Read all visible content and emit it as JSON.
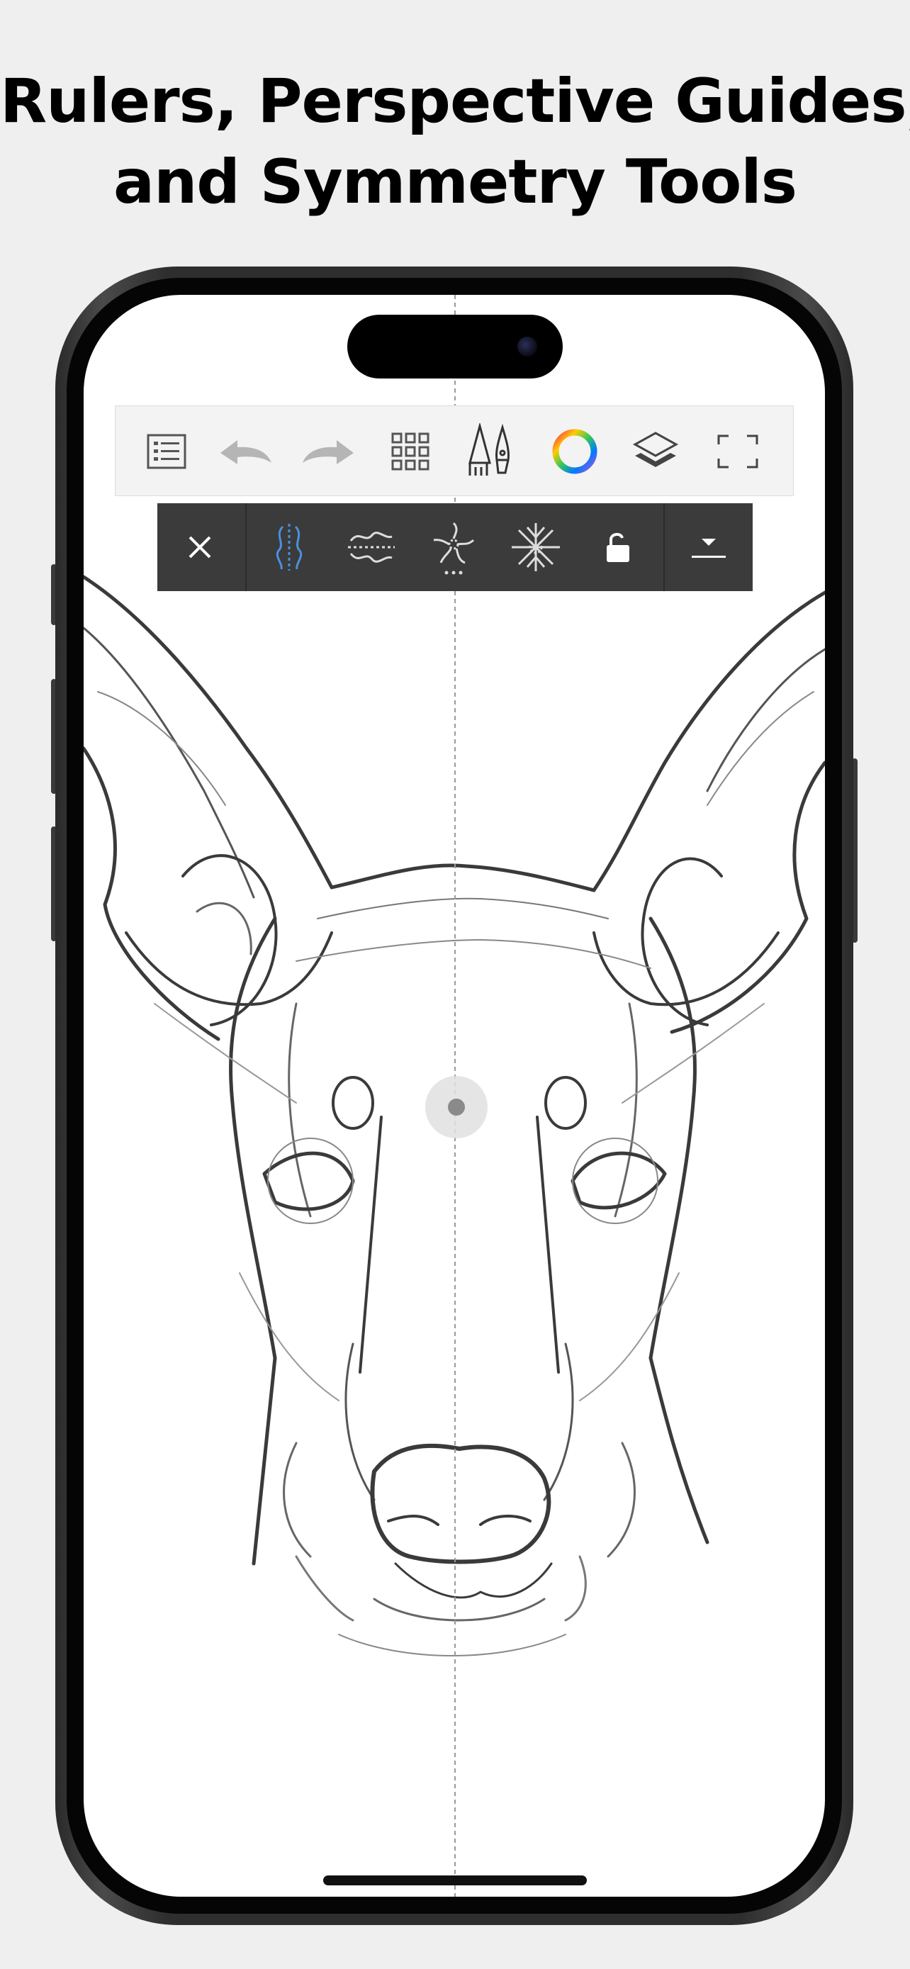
{
  "headline": {
    "line1": "Rulers, Perspective Guides,",
    "line2": "and Symmetry Tools"
  },
  "colors": {
    "background": "#efefef",
    "toolbar": "#f3f3f3",
    "symmetry_bar": "#3b3b3b",
    "accent": "#4a90e2",
    "guide_line": "#9a9a9a"
  },
  "toolbar": {
    "buttons": [
      "list-icon",
      "undo-icon",
      "redo-icon",
      "grid-icon",
      "brush-library-icon",
      "color-wheel-icon",
      "layers-icon",
      "fullscreen-icon"
    ]
  },
  "symmetry_bar": {
    "buttons": [
      "close-icon",
      "vertical-symmetry-icon",
      "horizontal-symmetry-icon",
      "radial-symmetry-icon",
      "kaleidoscope-symmetry-icon",
      "unlock-icon",
      "collapse-icon"
    ],
    "active": "vertical-symmetry-icon"
  },
  "canvas": {
    "content": "dog-head-sketch-image"
  }
}
